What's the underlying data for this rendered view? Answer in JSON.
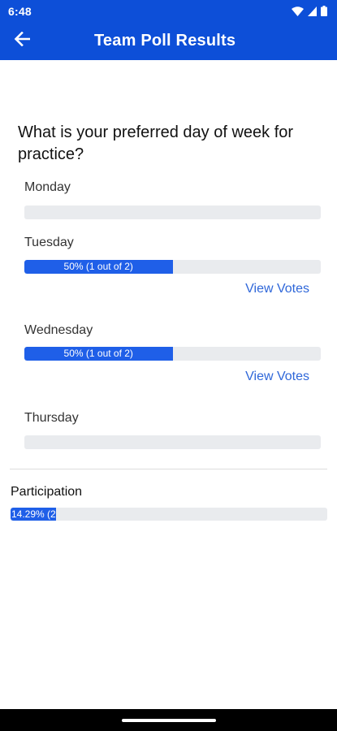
{
  "status_bar": {
    "time": "6:48"
  },
  "app_bar": {
    "title": "Team Poll Results",
    "back_icon": "arrow-left-icon"
  },
  "poll": {
    "question": "What is your preferred day of week for practice?",
    "options": [
      {
        "label": "Monday",
        "fraction": 0,
        "bar_text": "",
        "view_votes": ""
      },
      {
        "label": "Tuesday",
        "fraction": 0.5,
        "bar_text": "50% (1 out of 2)",
        "view_votes": "View Votes"
      },
      {
        "label": "Wednesday",
        "fraction": 0.5,
        "bar_text": "50% (1 out of 2)",
        "view_votes": "View Votes"
      },
      {
        "label": "Thursday",
        "fraction": 0,
        "bar_text": "",
        "view_votes": ""
      }
    ]
  },
  "participation": {
    "label": "Participation",
    "fraction": 0.1429,
    "bar_text": "14.29% (2"
  },
  "colors": {
    "primary": "#0d4fd8",
    "bar_fill": "#1f5fe8",
    "bar_track": "#e9ebee",
    "link": "#2f67d9"
  }
}
